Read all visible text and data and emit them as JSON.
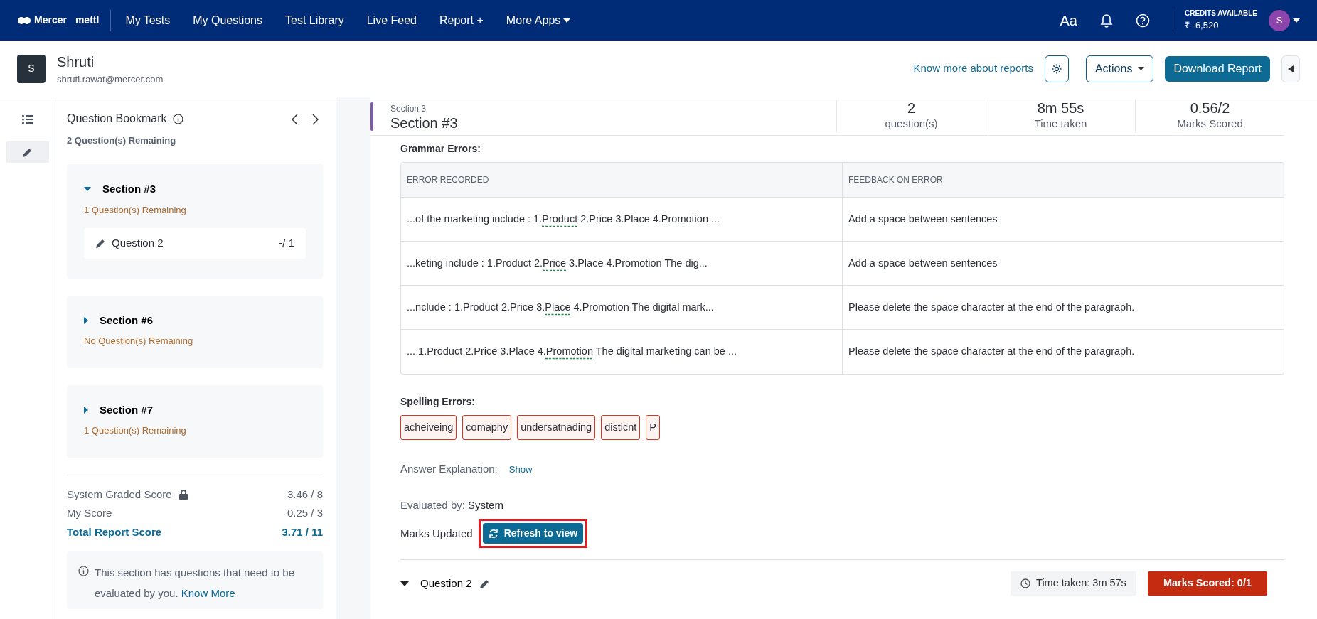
{
  "nav": {
    "brand": "Mercer",
    "brand_sub": "mettl",
    "items": [
      {
        "label": "My Tests",
        "dropdown": false
      },
      {
        "label": "My Questions",
        "dropdown": false
      },
      {
        "label": "Test Library",
        "dropdown": false
      },
      {
        "label": "Live Feed",
        "dropdown": false
      },
      {
        "label": "Report +",
        "dropdown": false
      },
      {
        "label": "More Apps",
        "dropdown": true
      }
    ],
    "font_button": "Aa",
    "credits_label": "CREDITS AVAILABLE",
    "credits_value": "₹ -6,520",
    "avatar": "S"
  },
  "candidate": {
    "avatar": "S",
    "name": "Shruti",
    "email": "shruti.rawat@mercer.com",
    "know_more": "Know more about reports",
    "actions": "Actions",
    "download": "Download Report"
  },
  "rail": [
    {
      "kind": "list",
      "selected": false
    },
    {
      "kind": "pencil",
      "selected": true
    }
  ],
  "bookmark": {
    "title": "Question Bookmark",
    "remaining": "2 Question(s) Remaining",
    "sections": [
      {
        "title": "Section #3",
        "remaining": "1 Question(s) Remaining",
        "expanded": true,
        "questions": [
          {
            "label": "Question 2",
            "score": "-/ 1"
          }
        ]
      },
      {
        "title": "Section #6",
        "remaining": "No Question(s) Remaining",
        "expanded": false
      },
      {
        "title": "Section #7",
        "remaining": "1 Question(s) Remaining",
        "expanded": false
      }
    ],
    "scores": [
      {
        "label": "System Graded Score",
        "value": "3.46 / 8",
        "locked": true,
        "total": false
      },
      {
        "label": "My Score",
        "value": "0.25 / 3",
        "locked": false,
        "total": false
      },
      {
        "label": "Total Report Score",
        "value": "3.71 / 11",
        "locked": false,
        "total": true
      }
    ],
    "notice": "This section has questions that need to be evaluated by you.",
    "notice_link": "Know More"
  },
  "section": {
    "caption": "Section 3",
    "title": "Section #3",
    "stats": [
      {
        "value": "2",
        "label": "question(s)"
      },
      {
        "value": "8m 55s",
        "label": "Time taken"
      },
      {
        "value": "0.56/2",
        "label": "Marks Scored"
      }
    ]
  },
  "grammar": {
    "title": "Grammar Errors:",
    "columns": [
      "ERROR RECORDED",
      "FEEDBACK ON ERROR"
    ],
    "rows": [
      {
        "before": "...of the marketing include : 1.",
        "error": "Product",
        "after": " 2.Price 3.Place 4.Promotion ...",
        "feedback": "Add a space between sentences"
      },
      {
        "before": "...keting include : 1.Product 2.",
        "error": "Price",
        "after": " 3.Place 4.Promotion The dig...",
        "feedback": "Add a space between sentences"
      },
      {
        "before": "...nclude : 1.Product 2.Price 3.",
        "error": "Place",
        "after": " 4.Promotion The digital mark...",
        "feedback": "Please delete the space character at the end of the paragraph."
      },
      {
        "before": "... 1.Product 2.Price 3.Place 4.",
        "error": "Promotion",
        "after": " The digital marketing can be ...",
        "feedback": "Please delete the space character at the end of the paragraph."
      }
    ]
  },
  "spelling": {
    "title": "Spelling Errors:",
    "words": [
      "acheiveing",
      "comapny",
      "undersatnading",
      "disticnt",
      "P"
    ]
  },
  "explanation": {
    "label": "Answer Explanation:",
    "link": "Show"
  },
  "evaluated": {
    "label": "Evaluated by:",
    "value": "System"
  },
  "marks_updated": {
    "label": "Marks Updated",
    "button": "Refresh to view",
    "highlighted": true
  },
  "question": {
    "title": "Question 2",
    "expanded": true,
    "time": "Time taken: 3m 57s",
    "marks": "Marks Scored: 0/1"
  }
}
